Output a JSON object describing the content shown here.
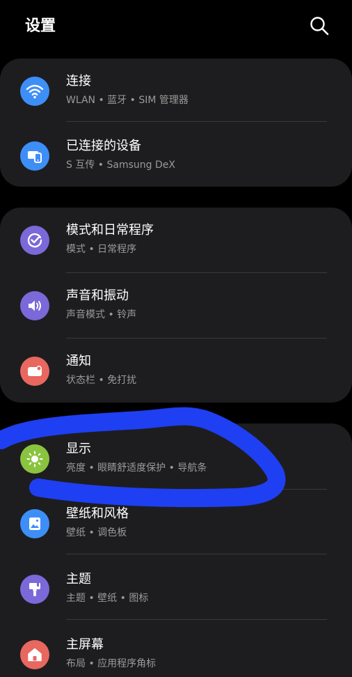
{
  "header": {
    "title": "设置",
    "search_icon": "search-icon"
  },
  "groups": [
    {
      "items": [
        {
          "title": "连接",
          "subtitle": "WLAN • 蓝牙 • SIM 管理器",
          "icon": "wifi-icon",
          "color": "#3e8ef7"
        },
        {
          "title": "已连接的设备",
          "subtitle": "S 互传 • Samsung DeX",
          "icon": "connected-devices-icon",
          "color": "#3e8ef7"
        }
      ]
    },
    {
      "items": [
        {
          "title": "模式和日常程序",
          "subtitle": "模式 • 日常程序",
          "icon": "modes-check-icon",
          "color": "#7b68d9"
        },
        {
          "title": "声音和振动",
          "subtitle": "声音模式 • 铃声",
          "icon": "sound-icon",
          "color": "#7b68d9"
        },
        {
          "title": "通知",
          "subtitle": "状态栏 • 免打扰",
          "icon": "notification-icon",
          "color": "#e8675f"
        }
      ]
    },
    {
      "items": [
        {
          "title": "显示",
          "subtitle": "亮度 • 眼睛舒适度保护 • 导航条",
          "icon": "brightness-icon",
          "color": "#8ac43f"
        },
        {
          "title": "壁纸和风格",
          "subtitle": "壁纸 • 调色板",
          "icon": "wallpaper-icon",
          "color": "#3e8ef7"
        },
        {
          "title": "主题",
          "subtitle": "主题 • 壁纸 • 图标",
          "icon": "theme-brush-icon",
          "color": "#7b68d9"
        },
        {
          "title": "主屏幕",
          "subtitle": "布局 • 应用程序角标",
          "icon": "home-icon",
          "color": "#e8675f"
        }
      ]
    }
  ],
  "annotation": {
    "scribble_color": "#1f3ff2"
  }
}
